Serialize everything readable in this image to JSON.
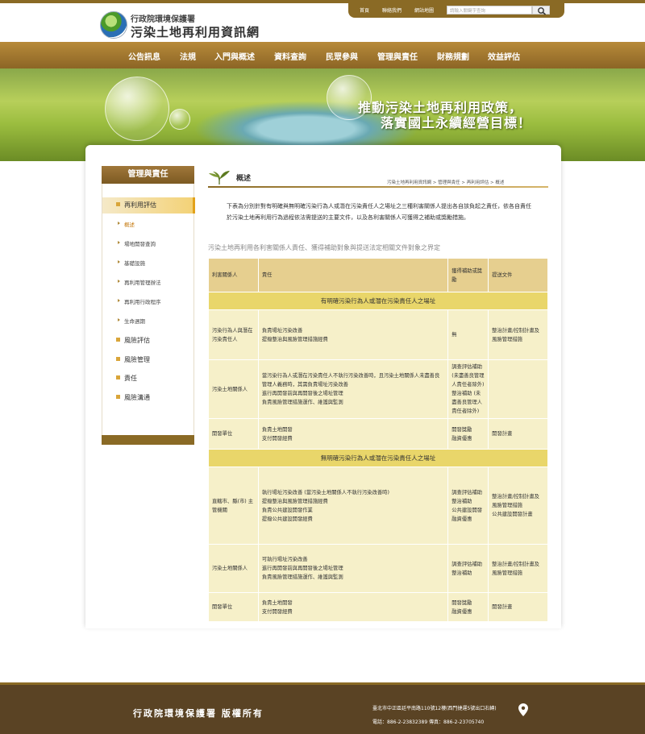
{
  "header": {
    "org": "行政院環境保護署",
    "site_title": "污染土地再利用資訊網"
  },
  "toolbar": {
    "links": [
      "首頁",
      "聯絡我們",
      "網站地圖"
    ],
    "search_placeholder": "請輸入關鍵字查詢"
  },
  "nav": {
    "items": [
      "公告訊息",
      "法規",
      "入門與概述",
      "資料查詢",
      "民眾參與",
      "管理與責任",
      "財務規劃",
      "效益評估"
    ]
  },
  "banner": {
    "line1": "推動污染土地再利用政策，",
    "line2": "落實國土永續經營目標！"
  },
  "sidebar": {
    "heading": "管理與責任",
    "items": [
      {
        "label": "再利用評估",
        "type": "main",
        "active": true
      },
      {
        "label": "概述",
        "type": "sub",
        "current": true
      },
      {
        "label": "場地開發查詢",
        "type": "sub"
      },
      {
        "label": "基礎設施",
        "type": "sub"
      },
      {
        "label": "再利用管理辦法",
        "type": "sub"
      },
      {
        "label": "再利用行政程序",
        "type": "sub"
      },
      {
        "label": "生命週期",
        "type": "sub"
      },
      {
        "label": "風險評估",
        "type": "main"
      },
      {
        "label": "風險管理",
        "type": "main"
      },
      {
        "label": "責任",
        "type": "main"
      },
      {
        "label": "風險溝通",
        "type": "main"
      }
    ]
  },
  "main": {
    "title": "概述",
    "breadcrumb": "污染土地再利用資訊網 > 管理與責任 > 再利用評估 > 概述",
    "intro": "下表為分別針對有明確與無明確污染行為人或潛在污染責任人之場址之三種利害關係人提出各自該負起之責任，依各自責任於污染土地再利用行為過程依法需提送的主要文件，以及各利害關係人可獲得之補助或獎勵措施。",
    "caption": "污染土地再利用各利害關係人責任、獲得補助對象與提送法定相關文件對象之界定",
    "table": {
      "headers": [
        "利害關係人",
        "責任",
        "獲得補助或獎勵",
        "提送文件"
      ],
      "sections": [
        {
          "title": "有明確污染行為人或潛在污染責任人之場址",
          "rows": [
            {
              "party": "污染行為人與潛在污染責任人",
              "duties": [
                "負責場址污染改善",
                "提撥整治與風險管理措施經費"
              ],
              "aid": [
                "無"
              ],
              "docs": [
                "整治計畫/控制計畫及風險管理措施"
              ]
            },
            {
              "party": "污染土地關係人",
              "duties": [
                "當污染行為人或潛在污染責任人不執行污染改善時，且污染土地關係人未盡善良管理人義務時，其需負責場址污染改善",
                "進行再開發前與再開發後之場址管理",
                "負責風險管理措施運作、維護與監測"
              ],
              "aid": [
                "調查評估補助 (未盡善良管理人責任者除外)",
                "整治補助 (未盡善良管理人責任者除外)"
              ],
              "docs": []
            },
            {
              "party": "開發單位",
              "duties": [
                "負責土地開發",
                "支付開發經費"
              ],
              "aid": [
                "開發獎勵",
                "融資優惠"
              ],
              "docs": [
                "開發計畫"
              ]
            }
          ]
        },
        {
          "title": "無明確污染行為人或潛在污染責任人之場址",
          "rows": [
            {
              "party": "直轄市、縣(市) 主管機關",
              "duties": [
                "執行場址污染改善 (當污染土地關係人不執行污染改善時)",
                "提撥整治與風險管理措施經費",
                "負責公共建設開發作業",
                "提撥公共建設開發經費"
              ],
              "aid": [
                "調查評估補助",
                "整治補助",
                "公共建設開發融資優惠"
              ],
              "docs": [
                "整治計畫/控制計畫及風險管理措施",
                "公共建設開發計畫"
              ]
            },
            {
              "party": "污染土地關係人",
              "duties": [
                "可執行場址污染改善",
                "進行再開發前與再開發後之場址管理",
                "負責風險管理措施運作、維護與監測"
              ],
              "aid": [
                "調查評估補助",
                "整治補助"
              ],
              "docs": [
                "整治計畫/控制計畫及風險管理措施"
              ]
            },
            {
              "party": "開發單位",
              "duties": [
                "負責土地開發",
                "支付開發經費"
              ],
              "aid": [
                "開發獎勵",
                "融資優惠"
              ],
              "docs": [
                "開發計畫"
              ]
            }
          ]
        }
      ]
    }
  },
  "footer": {
    "copyright": "行政院環境保護署 版權所有",
    "address": "臺北市中正區廷平南路110號12樓(西門捷運5號出口右轉)",
    "phone": "電話：886-2-23832389 傳真：886-2-23705740"
  },
  "colors": {
    "brand_brown": "#8a6a25",
    "accent_gold": "#e2a21a",
    "table_header": "#e6cf8f",
    "table_cell": "#f6f0c9",
    "section_row": "#e9d66a"
  }
}
